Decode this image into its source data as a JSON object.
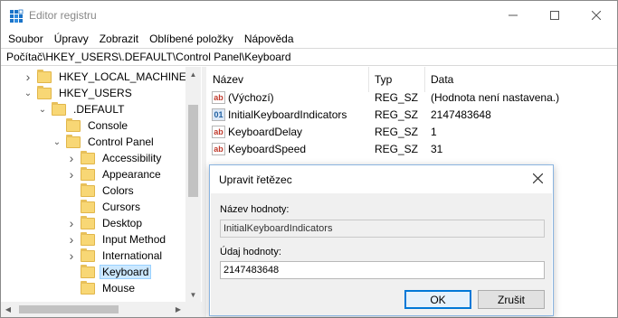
{
  "window": {
    "title": "Editor registru"
  },
  "menu": [
    {
      "label": "Soubor"
    },
    {
      "label": "Úpravy"
    },
    {
      "label": "Zobrazit"
    },
    {
      "label": "Oblíbené položky"
    },
    {
      "label": "Nápověda"
    }
  ],
  "address": {
    "path": "Počítač\\HKEY_USERS\\.DEFAULT\\Control Panel\\Keyboard"
  },
  "tree": {
    "items": [
      {
        "label": "HKEY_LOCAL_MACHINE",
        "expander": "collapsed"
      },
      {
        "label": "HKEY_USERS",
        "expander": "expanded"
      },
      {
        "label": ".DEFAULT",
        "expander": "expanded"
      },
      {
        "label": "Console",
        "expander": "none"
      },
      {
        "label": "Control Panel",
        "expander": "expanded"
      },
      {
        "label": "Accessibility",
        "expander": "collapsed"
      },
      {
        "label": "Appearance",
        "expander": "collapsed"
      },
      {
        "label": "Colors",
        "expander": "none"
      },
      {
        "label": "Cursors",
        "expander": "none"
      },
      {
        "label": "Desktop",
        "expander": "collapsed"
      },
      {
        "label": "Input Method",
        "expander": "collapsed"
      },
      {
        "label": "International",
        "expander": "collapsed"
      },
      {
        "label": "Keyboard",
        "expander": "none",
        "selected": true
      },
      {
        "label": "Mouse",
        "expander": "none"
      }
    ]
  },
  "values": {
    "columns": {
      "name": "Název",
      "type": "Typ",
      "data": "Data"
    },
    "rows": [
      {
        "icon": "string-value-icon",
        "kind": "sz",
        "name": "(Výchozí)",
        "type": "REG_SZ",
        "data": "(Hodnota není nastavena.)"
      },
      {
        "icon": "binary-value-icon",
        "kind": "bin",
        "name": "InitialKeyboardIndicators",
        "type": "REG_SZ",
        "data": "2147483648"
      },
      {
        "icon": "string-value-icon",
        "kind": "sz",
        "name": "KeyboardDelay",
        "type": "REG_SZ",
        "data": "1"
      },
      {
        "icon": "string-value-icon",
        "kind": "sz",
        "name": "KeyboardSpeed",
        "type": "REG_SZ",
        "data": "31"
      }
    ]
  },
  "dialog": {
    "title": "Upravit řetězec",
    "name_label": "Název hodnoty:",
    "name_value": "InitialKeyboardIndicators",
    "data_label": "Údaj hodnoty:",
    "data_value": "2147483648",
    "ok_label": "OK",
    "cancel_label": "Zrušit"
  },
  "icons": {
    "app": "registry-editor-icon",
    "minimize": "minimize-icon",
    "maximize": "maximize-icon",
    "close": "close-icon"
  }
}
